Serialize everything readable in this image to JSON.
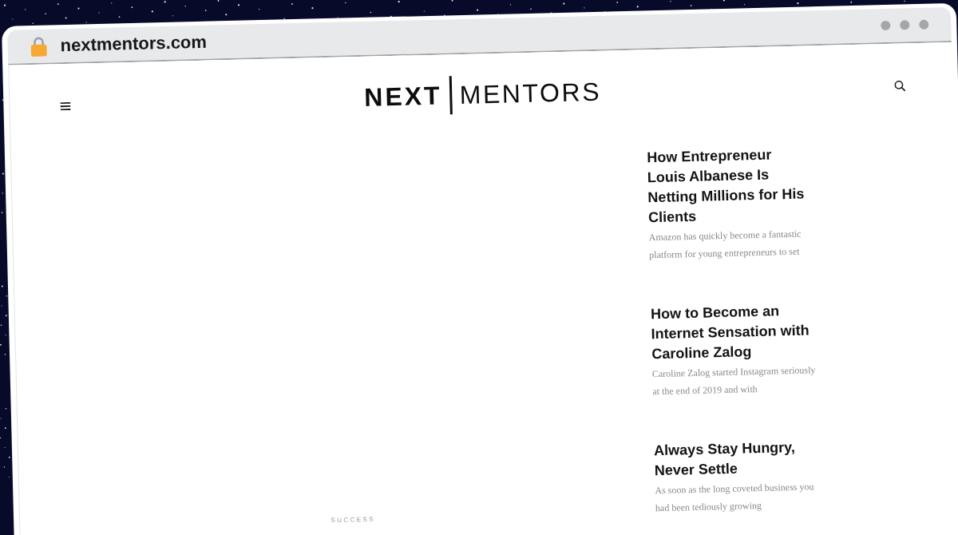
{
  "browser": {
    "secure": true,
    "url": "nextmentors.com"
  },
  "header": {
    "logo": {
      "primary": "NEXT",
      "secondary": "MENTORS"
    }
  },
  "featured": {
    "category": "SUCCESS"
  },
  "sidebar": {
    "articles": [
      {
        "title": "How Entrepreneur Louis Albanese Is Netting Millions for His Clients",
        "excerpt": "Amazon has quickly become a fantastic platform for young entrepreneurs to set"
      },
      {
        "title": "How to Become an Internet Sensation with Caroline Zalog",
        "excerpt": "Caroline Zalog started Instagram seriously at the end of 2019 and with"
      },
      {
        "title": "Always Stay Hungry, Never Settle",
        "excerpt": "As soon as the long coveted business you had been tediously growing"
      }
    ]
  }
}
